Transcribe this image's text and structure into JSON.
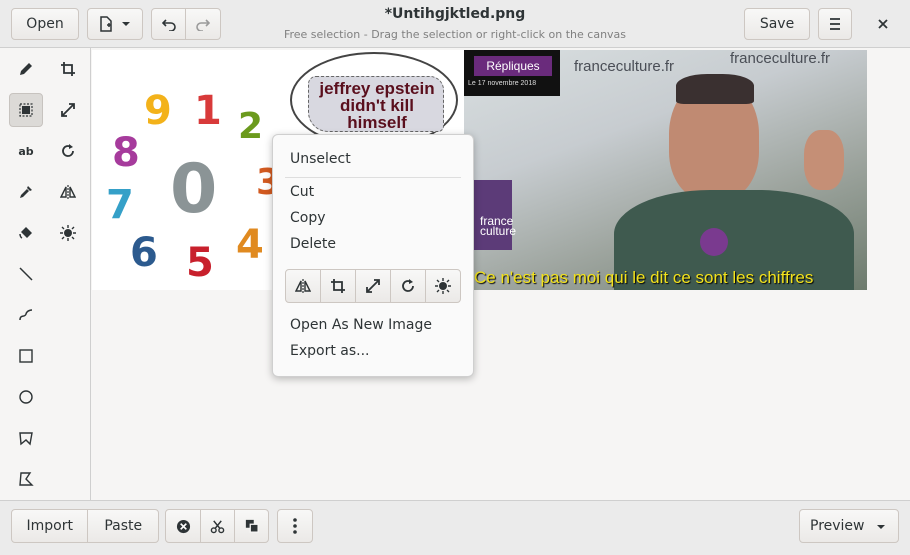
{
  "header": {
    "open_label": "Open",
    "title": "*Untihgjktled.png",
    "subtitle": "Free selection - Drag the selection or right-click on the canvas",
    "save_label": "Save"
  },
  "canvas": {
    "speech_bubble_text": "jeffrey epstein didn't kill himself",
    "photo_badge": "Répliques",
    "photo_date": "Le 17 novembre 2018",
    "photo_watermark_1": "franceculture.fr",
    "photo_watermark_2": "franceculture.fr",
    "photo_caption": "Ce n'est pas moi qui le dit ce sont les chiffres",
    "photo_logo": "france\nculture",
    "numbers": [
      "9",
      "1",
      "2",
      "8",
      "0",
      "3",
      "7",
      "6",
      "5",
      "4"
    ]
  },
  "context_menu": {
    "unselect": "Unselect",
    "cut": "Cut",
    "copy": "Copy",
    "delete": "Delete",
    "open_as_new_image": "Open As New Image",
    "export_as": "Export as..."
  },
  "bottombar": {
    "import_label": "Import",
    "paste_label": "Paste",
    "preview_label": "Preview"
  },
  "colors": {
    "accent_purple": "#6a2b7c",
    "caption_yellow": "#f2e21c"
  }
}
